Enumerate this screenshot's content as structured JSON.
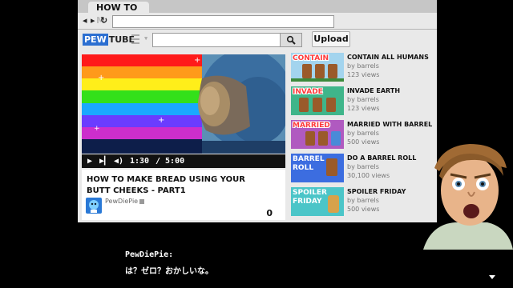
{
  "browser": {
    "tab_title": "HOW TO",
    "tab_title_fade": "M"
  },
  "site": {
    "logo_box": "PEW",
    "logo_rest": "TUBE",
    "upload_label": "Upload"
  },
  "player": {
    "time_current": "1:30",
    "time_total": "/ 5:00",
    "progress": 0.3
  },
  "video": {
    "title_line1": "HOW TO MAKE BREAD USING YOUR",
    "title_line2": "BUTT CHEEKS - PART1",
    "author": "PewDiePie",
    "count": "0"
  },
  "sidebar": {
    "items": [
      {
        "thumb_label": "CONTAIN",
        "title": "CONTAIN ALL HUMANS",
        "by": "by barrels",
        "views": "123 views",
        "bg": "#a3d4ee"
      },
      {
        "thumb_label": "INVADE",
        "title": "INVADE EARTH",
        "by": "by barrels",
        "views": "123 views",
        "bg": "#3fb58a"
      },
      {
        "thumb_label": "MARRIED",
        "title": "MARRIED WITH BARREL",
        "by": "by barrels",
        "views": "500 views",
        "bg": "#b05ac0"
      },
      {
        "thumb_label": "BARREL ROLL",
        "title": "DO A BARREL ROLL",
        "by": "by barrels",
        "views": "30,100 views",
        "bg": "#3c6de0"
      },
      {
        "thumb_label": "SPOILER FRIDAY",
        "title": "SPOILER FRIDAY",
        "by": "by barrels",
        "views": "500 views",
        "bg": "#4bc5c8"
      }
    ]
  },
  "dialog": {
    "speaker": "PewDiePie:",
    "text": "は？ゼロ？おかしいな。"
  },
  "colors": {
    "logo_blue": "#2c6fd1",
    "background": "#000000"
  }
}
